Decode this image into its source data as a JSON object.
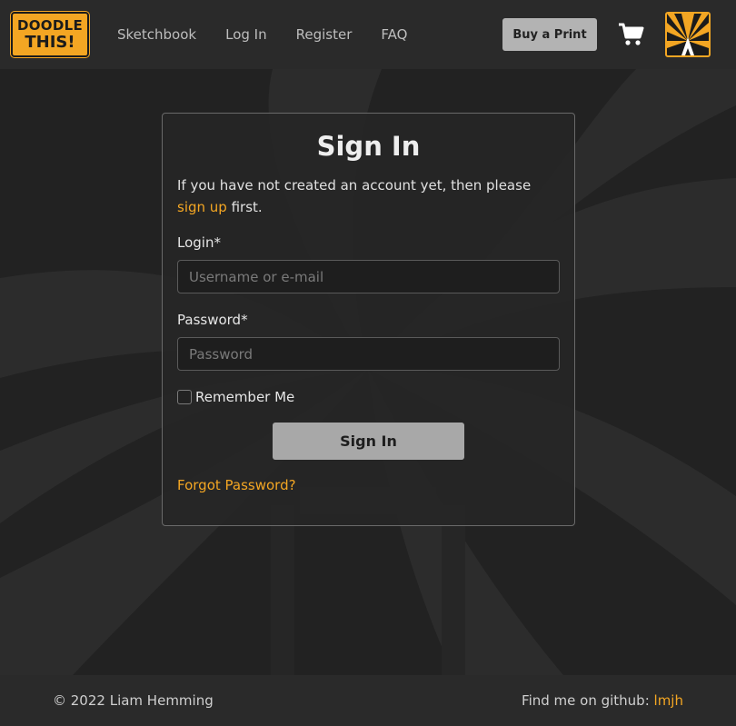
{
  "brand": {
    "logo_line1": "DOODLE",
    "logo_line2": "THIS!",
    "accent_color": "#f3a623"
  },
  "nav": {
    "links": [
      "Sketchbook",
      "Log In",
      "Register",
      "FAQ"
    ],
    "buy_label": "Buy a Print",
    "cart_icon": "shopping-cart-icon",
    "brand_icon": "pencil-sunburst-icon"
  },
  "signin": {
    "title": "Sign In",
    "intro_before": "If you have not created an account yet, then please ",
    "intro_link": "sign up",
    "intro_after": " first.",
    "login_label": "Login*",
    "login_placeholder": "Username or e-mail",
    "login_value": "",
    "password_label": "Password*",
    "password_placeholder": "Password",
    "password_value": "",
    "remember_label": "Remember Me",
    "remember_checked": false,
    "submit_label": "Sign In",
    "forgot_label": "Forgot Password?"
  },
  "footer": {
    "copyright": "© 2022 Liam Hemming",
    "github_prefix": "Find me on github: ",
    "github_link": "lmjh"
  }
}
